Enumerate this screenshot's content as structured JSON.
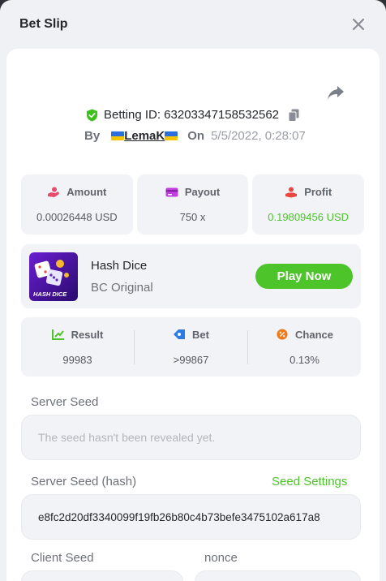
{
  "modal": {
    "title": "Bet Slip",
    "close_icon": "close-icon",
    "share_icon": "share-arrow-icon"
  },
  "bet": {
    "id_label": "Betting ID: 63203347158532562",
    "by_label": "By",
    "username": "LemaK",
    "on_label": "On",
    "date": "5/5/2022, 0:28:07"
  },
  "stats": [
    {
      "label": "Amount",
      "value": "0.00026448 USD",
      "icon": "amount-hand-icon",
      "value_color": "#555962"
    },
    {
      "label": "Payout",
      "value": "750 x",
      "icon": "payout-card-icon",
      "value_color": "#555962"
    },
    {
      "label": "Profit",
      "value": "0.19809456 USD",
      "icon": "profit-hand-icon",
      "value_color": "#4cc42a"
    }
  ],
  "game": {
    "name": "Hash Dice",
    "provider": "BC Original",
    "thumb_text": "HASH DICE",
    "play_label": "Play Now"
  },
  "result": [
    {
      "label": "Result",
      "value": "99983",
      "icon": "result-chart-icon"
    },
    {
      "label": "Bet",
      "value": ">99867",
      "icon": "bet-tag-icon"
    },
    {
      "label": "Chance",
      "value": "0.13%",
      "icon": "chance-percent-icon"
    }
  ],
  "seeds": {
    "server_seed_label": "Server Seed",
    "server_seed_placeholder": "The seed hasn't been revealed yet.",
    "server_hash_label": "Server Seed (hash)",
    "seed_settings_label": "Seed Settings",
    "server_hash_value": "e8fc2d20df3340099f19fb26b80c4b73befe3475102a617a8",
    "client_seed_label": "Client Seed",
    "nonce_label": "nonce"
  },
  "colors": {
    "accent_green": "#4cc42a",
    "amount_icon": "#e84a6b",
    "payout_icon": "#c23ee0",
    "profit_icon": "#e8473f",
    "result_icon": "#4cc42a",
    "bet_icon": "#2b7be8",
    "chance_icon": "#f07a1a"
  }
}
